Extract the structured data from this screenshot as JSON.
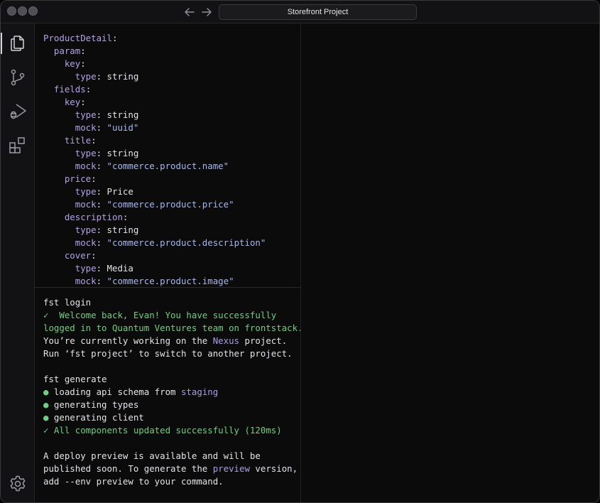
{
  "window": {
    "title": "Storefront Project"
  },
  "activity_bar": {
    "icons": [
      "files-icon",
      "source-control-icon",
      "run-debug-icon",
      "extensions-icon",
      "settings-gear-icon"
    ]
  },
  "editor": {
    "lines": [
      {
        "indent": "",
        "key": "ProductDetail",
        "sep": ":",
        "val": "",
        "val_type": ""
      },
      {
        "indent": "  ",
        "key": "param",
        "sep": ":",
        "val": "",
        "val_type": ""
      },
      {
        "indent": "    ",
        "key": "key",
        "sep": ":",
        "val": "",
        "val_type": ""
      },
      {
        "indent": "      ",
        "key": "type",
        "sep": ": ",
        "val": "string",
        "val_type": "plain"
      },
      {
        "indent": "  ",
        "key": "fields",
        "sep": ":",
        "val": "",
        "val_type": ""
      },
      {
        "indent": "    ",
        "key": "key",
        "sep": ":",
        "val": "",
        "val_type": ""
      },
      {
        "indent": "      ",
        "key": "type",
        "sep": ": ",
        "val": "string",
        "val_type": "plain"
      },
      {
        "indent": "      ",
        "key": "mock",
        "sep": ": ",
        "val": "\"uuid\"",
        "val_type": "string"
      },
      {
        "indent": "    ",
        "key": "title",
        "sep": ":",
        "val": "",
        "val_type": ""
      },
      {
        "indent": "      ",
        "key": "type",
        "sep": ": ",
        "val": "string",
        "val_type": "plain"
      },
      {
        "indent": "      ",
        "key": "mock",
        "sep": ": ",
        "val": "\"commerce.product.name\"",
        "val_type": "string"
      },
      {
        "indent": "    ",
        "key": "price",
        "sep": ":",
        "val": "",
        "val_type": ""
      },
      {
        "indent": "      ",
        "key": "type",
        "sep": ": ",
        "val": "Price",
        "val_type": "plain"
      },
      {
        "indent": "      ",
        "key": "mock",
        "sep": ": ",
        "val": "\"commerce.product.price\"",
        "val_type": "string"
      },
      {
        "indent": "    ",
        "key": "description",
        "sep": ":",
        "val": "",
        "val_type": ""
      },
      {
        "indent": "      ",
        "key": "type",
        "sep": ": ",
        "val": "string",
        "val_type": "plain"
      },
      {
        "indent": "      ",
        "key": "mock",
        "sep": ": ",
        "val": "\"commerce.product.description\"",
        "val_type": "string"
      },
      {
        "indent": "    ",
        "key": "cover",
        "sep": ":",
        "val": "",
        "val_type": ""
      },
      {
        "indent": "      ",
        "key": "type",
        "sep": ": ",
        "val": "Media",
        "val_type": "plain"
      },
      {
        "indent": "      ",
        "key": "mock",
        "sep": ": ",
        "val": "\"commerce.product.image\"",
        "val_type": "string"
      }
    ]
  },
  "terminal": {
    "lines": [
      [
        {
          "t": "fst login",
          "c": "p"
        }
      ],
      [
        {
          "t": "✓ ",
          "c": "g"
        },
        {
          "t": " Welcome back, Evan! You have successfully",
          "c": "g"
        }
      ],
      [
        {
          "t": "logged in to Quantum Ventures team on frontstack.",
          "c": "g"
        }
      ],
      [
        {
          "t": "You’re currently working on the ",
          "c": "p"
        },
        {
          "t": "Nexus",
          "c": "hl"
        },
        {
          "t": " project.",
          "c": "p"
        }
      ],
      [
        {
          "t": "Run ‘fst project’ to switch to another project.",
          "c": "p"
        }
      ],
      [],
      [
        {
          "t": "fst generate",
          "c": "p"
        }
      ],
      [
        {
          "t": "● ",
          "c": "dot"
        },
        {
          "t": "loading api schema from ",
          "c": "p"
        },
        {
          "t": "staging",
          "c": "hl"
        }
      ],
      [
        {
          "t": "● ",
          "c": "dot"
        },
        {
          "t": "generating types",
          "c": "p"
        }
      ],
      [
        {
          "t": "● ",
          "c": "dot"
        },
        {
          "t": "generating client",
          "c": "p"
        }
      ],
      [
        {
          "t": "✓ ",
          "c": "g"
        },
        {
          "t": "All components updated successfully (120ms)",
          "c": "g"
        }
      ],
      [],
      [
        {
          "t": "A deploy preview is available and will be",
          "c": "p"
        }
      ],
      [
        {
          "t": "published soon. To generate the ",
          "c": "p"
        },
        {
          "t": "preview",
          "c": "hl"
        },
        {
          "t": " version,",
          "c": "p"
        }
      ],
      [
        {
          "t": "add --env preview to your command.",
          "c": "p"
        }
      ]
    ]
  }
}
